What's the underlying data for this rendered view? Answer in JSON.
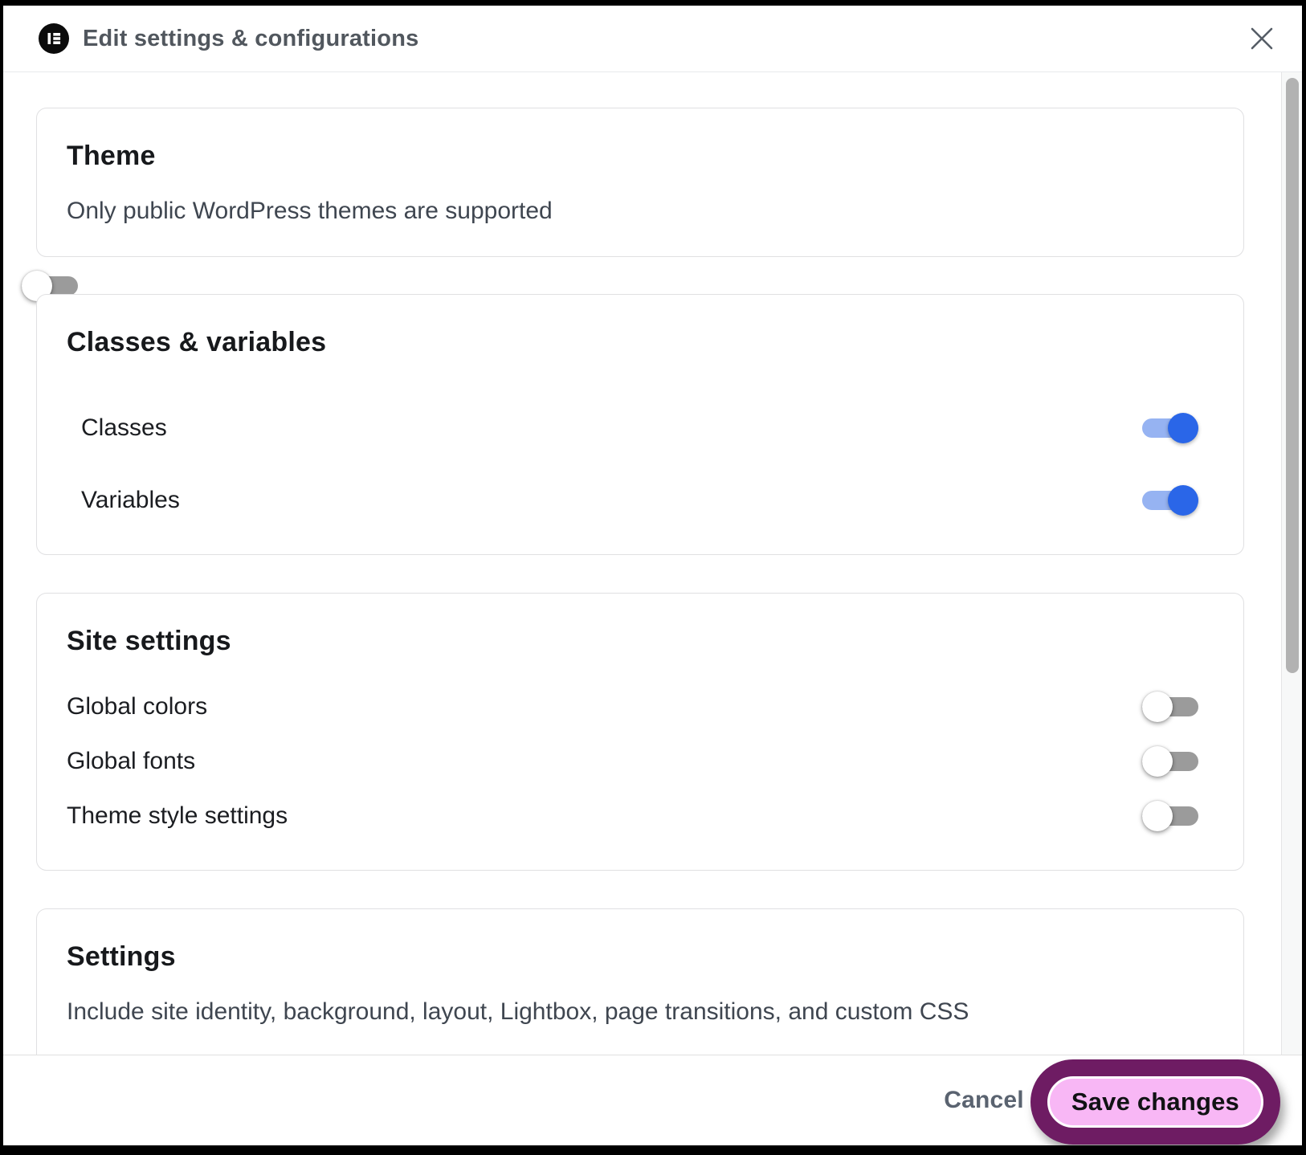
{
  "header": {
    "title": "Edit settings & configurations"
  },
  "sections": [
    {
      "title": "Theme",
      "subtitle": "Only public WordPress themes are supported",
      "toggle": "off"
    },
    {
      "title": "Classes & variables",
      "rows": [
        {
          "label": "Classes",
          "state": "on"
        },
        {
          "label": "Variables",
          "state": "on"
        }
      ]
    },
    {
      "title": "Site settings",
      "rows": [
        {
          "label": "Global colors",
          "state": "off"
        },
        {
          "label": "Global fonts",
          "state": "off"
        },
        {
          "label": "Theme style settings",
          "state": "off"
        }
      ]
    },
    {
      "title": "Settings",
      "subtitle": "Include site identity, background, layout, Lightbox, page transitions, and custom CSS",
      "toggle": "off"
    }
  ],
  "footer": {
    "cancel_label": "Cancel",
    "save_label": "Save changes"
  },
  "colors": {
    "toggle_on_knob": "#2a66e8",
    "toggle_on_track": "#96b3f2",
    "toggle_off_track": "#9b9b9b",
    "toggle_off_knob": "#ffffff",
    "highlight_ring": "#6e1c63",
    "highlight_fill": "#f8b7f5"
  }
}
